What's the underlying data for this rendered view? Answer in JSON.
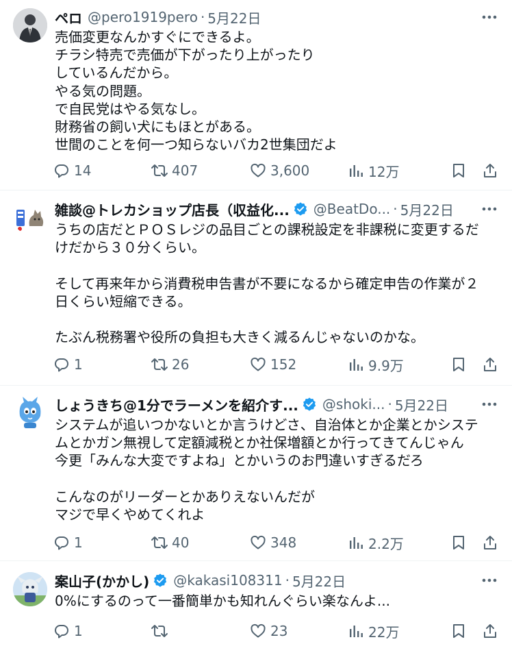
{
  "tweets": [
    {
      "name": "ペロ",
      "handle": "@pero1919pero",
      "date": "5月22日",
      "verified": false,
      "avatar_icon": "suited-man-avatar",
      "lines": [
        "売価変更なんかすぐにできるよ。",
        "チラシ特売で売価が下がったり上がったり",
        "しているんだから。",
        "やる気の問題。",
        "で自民党はやる気なし。",
        "財務省の飼い犬にもほとがある。",
        "世間のことを何一つ知らないバカ2世集団だよ"
      ],
      "replies": "14",
      "reposts": "407",
      "likes": "3,600",
      "views": "12万"
    },
    {
      "name": "雑談@トレカショップ店長（収益化...",
      "handle": "@BeatDo...",
      "date": "5月22日",
      "verified": true,
      "avatar_icon": "cat-illustration-avatar",
      "lines": [
        "うちの店だとＰＯＳレジの品目ごとの課税設定を非課税に変更するだ",
        "けだから３０分くらい。",
        "",
        "そして再来年から消費税申告書が不要になるから確定申告の作業が２",
        "日くらい短縮できる。",
        "",
        "たぶん税務署や役所の負担も大きく減るんじゃないのかな。"
      ],
      "replies": "1",
      "reposts": "26",
      "likes": "152",
      "views": "9.9万"
    },
    {
      "name": "しょうきち@1分でラーメンを紹介す...",
      "handle": "@shoki...",
      "date": "5月22日",
      "verified": true,
      "avatar_icon": "blue-cat-avatar",
      "lines": [
        "システムが追いつかないとか言うけどさ、自治体とか企業とかシステ",
        "ムとかガン無視して定額減税とか社保増額とか行ってきてんじゃん",
        "今更「みんな大変ですよね」とかいうのお門違いすぎるだろ",
        "",
        "こんなのがリーダーとかありえないんだが",
        "マジで早くやめてくれよ"
      ],
      "replies": "1",
      "reposts": "40",
      "likes": "348",
      "views": "2.2万"
    },
    {
      "name": "案山子(かかし)",
      "handle": "@kakasi108311",
      "date": "5月22日",
      "verified": true,
      "avatar_icon": "anime-character-avatar",
      "lines": [
        "0%にするのって一番簡単かも知れんぐらい楽なんよ..."
      ],
      "replies": "1",
      "reposts": "",
      "likes": "23",
      "views": "22万"
    }
  ],
  "separator": "·",
  "colors": {
    "text": "#0f1419",
    "secondary": "#536471",
    "verified": "#1d9bf0",
    "divider": "#eff3f4"
  }
}
